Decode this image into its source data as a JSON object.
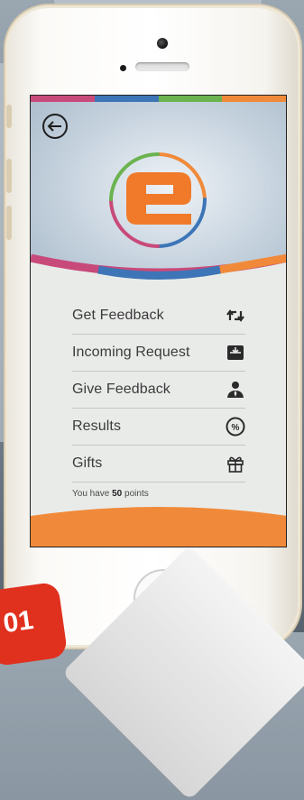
{
  "colors": {
    "bar": [
      "#c84a7a",
      "#3d75b7",
      "#6bb34f",
      "#f08a3a"
    ],
    "accent_orange": "#f08a3a",
    "logo_orange": "#f07a2a"
  },
  "header": {
    "back_icon": "back-arrow-icon",
    "logo": "app-logo-e"
  },
  "menu": {
    "items": [
      {
        "label": "Get Feedback",
        "icon": "swap-arrows-icon"
      },
      {
        "label": "Incoming Request",
        "icon": "inbox-icon"
      },
      {
        "label": "Give Feedback",
        "icon": "person-tie-icon"
      },
      {
        "label": "Results",
        "icon": "percent-circle-icon"
      },
      {
        "label": "Gifts",
        "icon": "gift-icon"
      }
    ]
  },
  "points": {
    "prefix": "You have",
    "value": "50",
    "suffix": "points"
  },
  "badge": {
    "text": "01"
  }
}
